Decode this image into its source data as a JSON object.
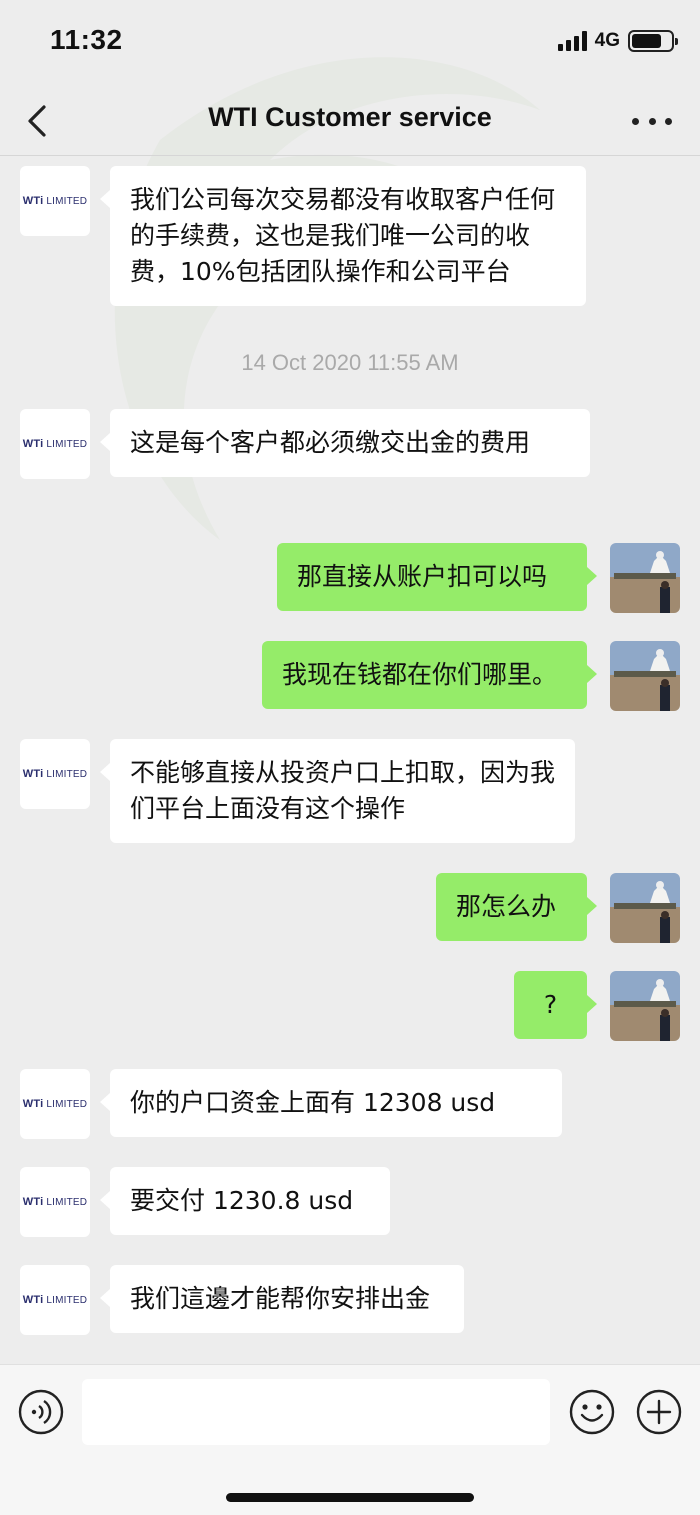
{
  "status_bar": {
    "time": "11:32",
    "network": "4G"
  },
  "header": {
    "title": "WTI Customer service"
  },
  "contact_avatar": {
    "logo_word": "WTi",
    "logo_suffix": "LIMITED"
  },
  "messages": [
    {
      "text": "我们公司每次交易都没有收取客户任何的手续费，这也是我们唯一公司的收费，10%包括团队操作和公司平台"
    },
    {
      "timestamp": "14 Oct 2020 11:55 AM"
    },
    {
      "text": "这是每个客户都必须缴交出金的费用"
    },
    {
      "text": "那直接从账户扣可以吗"
    },
    {
      "text": "我现在钱都在你们哪里。"
    },
    {
      "text": "不能够直接从投资户口上扣取，因为我们平台上面没有这个操作"
    },
    {
      "text": "那怎么办"
    },
    {
      "text": "?"
    },
    {
      "text": "你的户口资金上面有 12308 usd"
    },
    {
      "text": "要交付 1230.8 usd"
    },
    {
      "text": "我们這邊才能帮你安排出金"
    }
  ],
  "input": {
    "value": ""
  }
}
